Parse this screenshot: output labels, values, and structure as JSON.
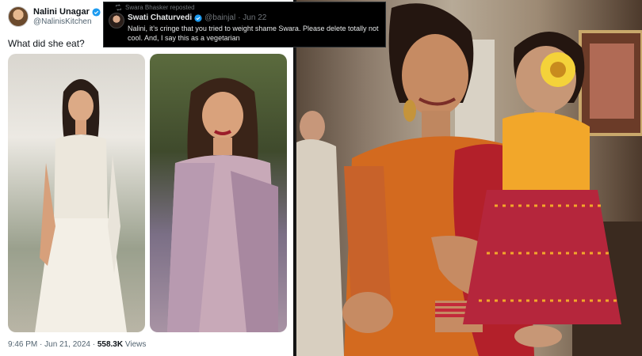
{
  "tweet": {
    "display_name": "Nalini Unagar",
    "handle": "@NalinisKitchen",
    "text": "What did she eat?",
    "time": "9:46 PM · Jun 21, 2024 · ",
    "views_count": "558.3K",
    "views_label": " Views"
  },
  "repost": {
    "reposted_by": "Swara Bhasker reposted",
    "name": "Swati Chaturvedi",
    "handle": "@bainjal",
    "date": "· Jun 22",
    "text": "Nalini, it’s cringe that you tried to weight shame Swara. Please delete totally not cool. And, I say this as a vegetarian"
  },
  "colors": {
    "verified": "#1d9bf0",
    "saree_orange": "#d36a1f",
    "saree_red": "#b3202a",
    "baby_yellow": "#f2a72a"
  },
  "icons": {
    "verified": "verified-badge-icon",
    "repost": "repost-icon",
    "emoji": "sunflower-emoji-icon"
  }
}
